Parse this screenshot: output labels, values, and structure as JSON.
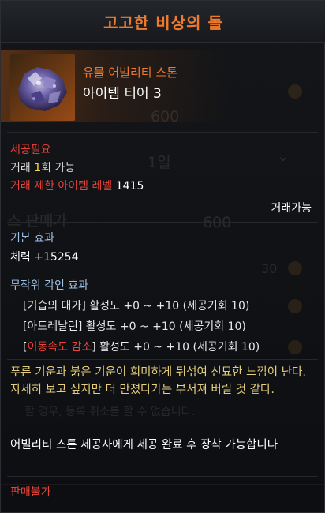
{
  "item": {
    "name": "고고한 비상의 돌",
    "rarity_type": "유물 어빌리티 스톤",
    "tier": "아이템 티어 3"
  },
  "trade": {
    "label": "세공필요",
    "count_prefix": "거래 ",
    "count_value": "1",
    "count_suffix": "회 가능",
    "level_label": "거래 제한 아이템 레벨",
    "level_value": "1415",
    "tradable": "거래가능"
  },
  "basic": {
    "title": "기본 효과",
    "stat": "체력 +15254"
  },
  "random": {
    "title": "무작위 각인 효과",
    "engravings": [
      {
        "open": "[",
        "name": "기습의 대가",
        "close": "]",
        "detail": " 활성도 +0 ~ +10 (세공기회 10)",
        "negative": false
      },
      {
        "open": "[",
        "name": "아드레날린",
        "close": "]",
        "detail": " 활성도 +0 ~ +10 (세공기회 10)",
        "negative": false
      },
      {
        "open": "[",
        "name": "이동속도 감소",
        "close": "]",
        "detail": " 활성도 +0 ~ +10 (세공기회 10)",
        "negative": true
      }
    ]
  },
  "description": "푸른 기운과 붉은 기운이 희미하게 뒤섞여 신묘한 느낌이 난다. 자세히 보고 싶지만 더 만졌다가는 부서져 버릴 것 같다.",
  "instruction": "어빌리티 스톤 세공사에게 세공 완료 후 장착 가능합니다",
  "sell": "판매불가",
  "colors": {
    "relic_orange": "#ee7b2d",
    "red": "#e8423a",
    "section_blue": "#9dc0e6",
    "highlight_gold": "#ffd94a",
    "flavor_yellow": "#e6cf7c"
  }
}
